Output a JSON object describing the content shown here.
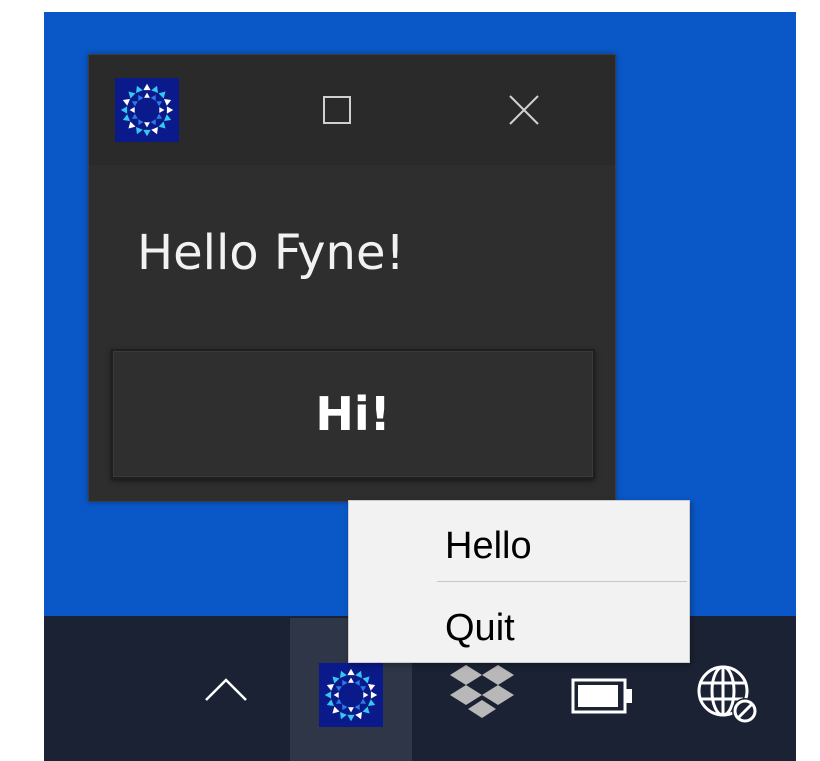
{
  "window": {
    "icon": "fyne-logo-icon",
    "maximize_icon": "maximize-icon",
    "close_icon": "close-icon",
    "label_text": "Hello Fyne!",
    "button_label": "Hi!"
  },
  "context_menu": {
    "items": [
      {
        "label": "Hello"
      },
      {
        "label": "Quit"
      }
    ]
  },
  "taskbar": {
    "tray_icons": [
      "show-hidden-icons-chevron-icon",
      "fyne-tray-icon",
      "dropbox-icon",
      "battery-icon",
      "network-no-internet-icon"
    ]
  },
  "colors": {
    "desktop": "#0a58c8",
    "taskbar": "#1b2233",
    "window_bg": "#2e2e2e",
    "titlebar_bg": "#2a2a2a",
    "menu_bg": "#f2f2f2",
    "fyne_icon_bg": "#0a1a8a",
    "fyne_icon_accent": "#36c8f0"
  }
}
